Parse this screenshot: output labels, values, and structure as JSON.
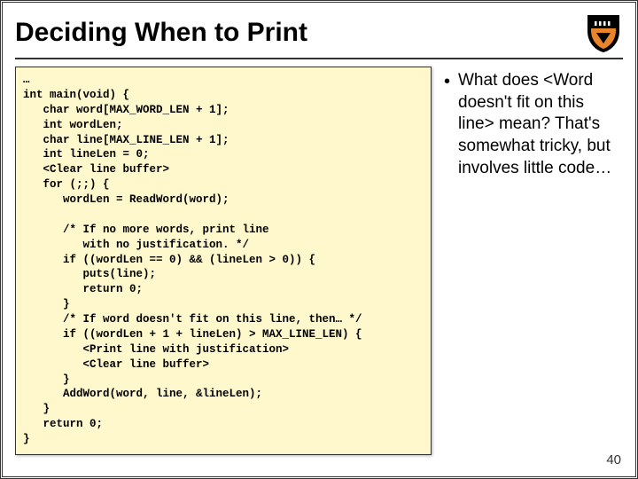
{
  "title": "Deciding When to Print",
  "code": "…\nint main(void) {\n   char word[MAX_WORD_LEN + 1];\n   int wordLen;\n   char line[MAX_LINE_LEN + 1];\n   int lineLen = 0;\n   <Clear line buffer>\n   for (;;) {\n      wordLen = ReadWord(word);\n\n      /* If no more words, print line\n         with no justification. */\n      if ((wordLen == 0) && (lineLen > 0)) {\n         puts(line);\n         return 0;\n      }\n      /* If word doesn't fit on this line, then… */\n      if ((wordLen + 1 + lineLen) > MAX_LINE_LEN) {\n         <Print line with justification>\n         <Clear line buffer>\n      }\n      AddWord(word, line, &lineLen);\n   }\n   return 0;\n}",
  "bullet": "What does <Word doesn't fit on this line> mean? That's somewhat tricky, but involves little code…",
  "page_number": "40",
  "shield_colors": {
    "outer": "#000",
    "inner": "#e8852a"
  }
}
